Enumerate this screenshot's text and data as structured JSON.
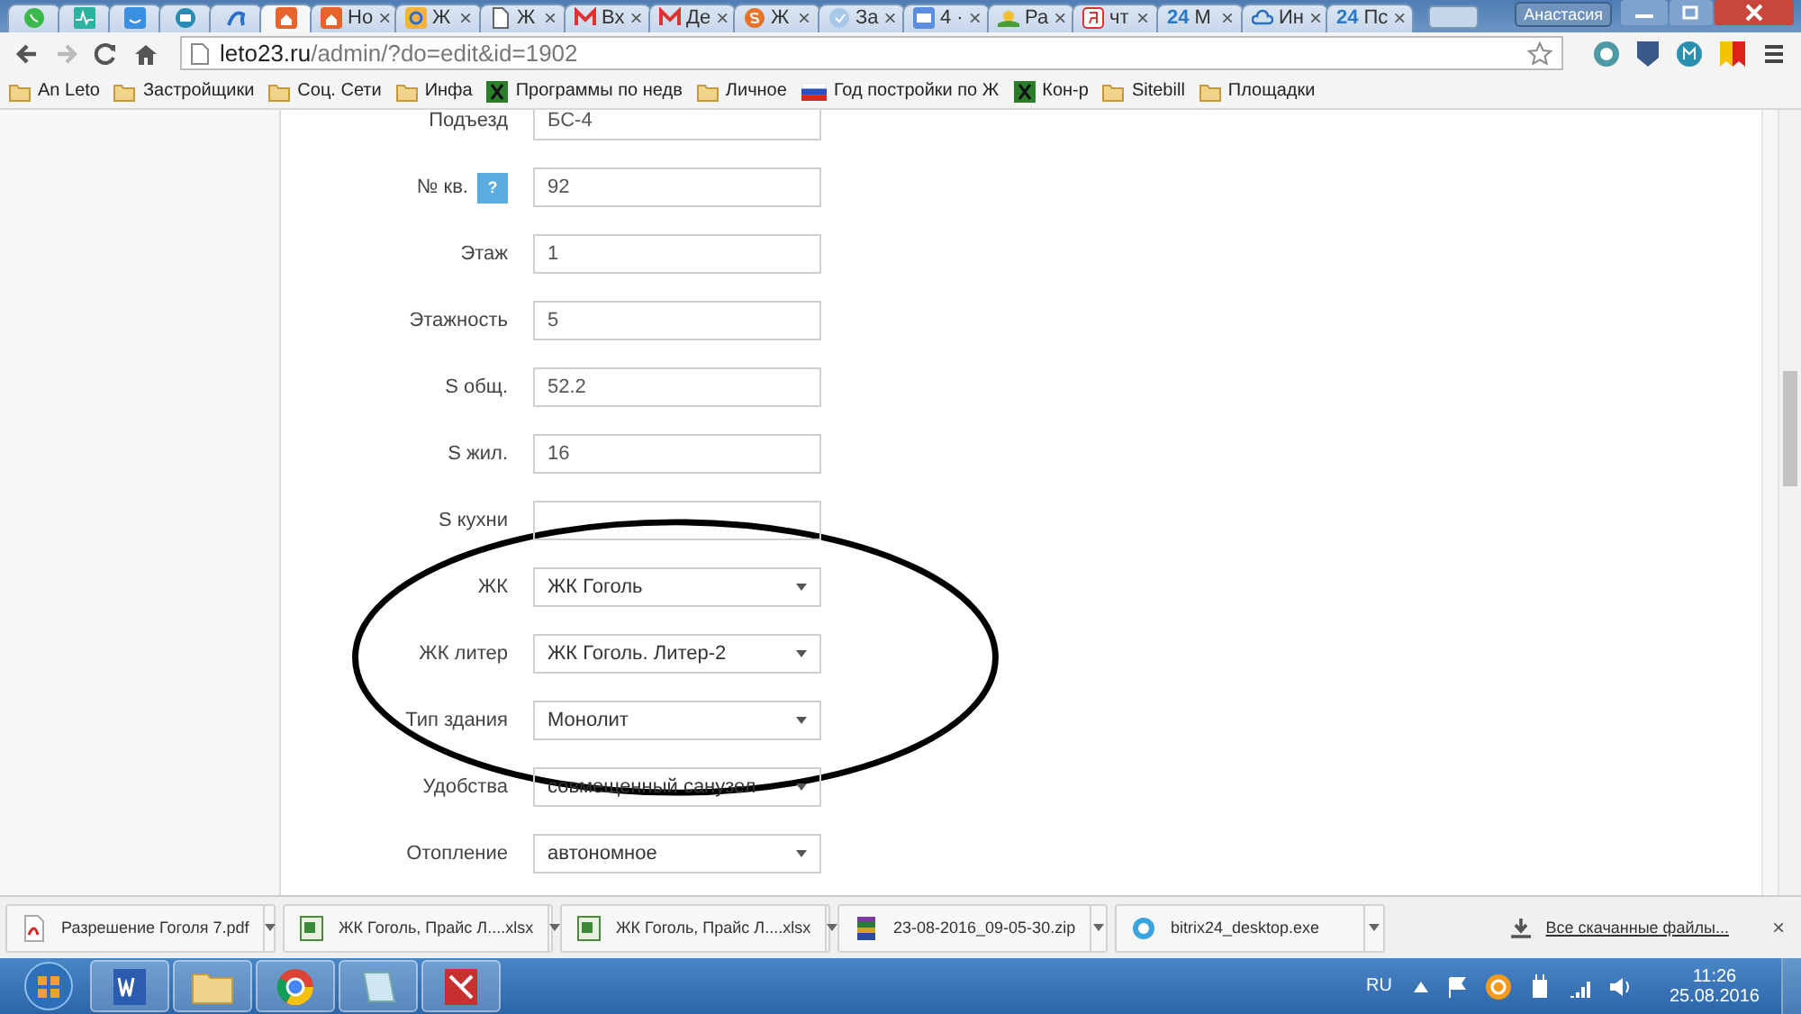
{
  "browser": {
    "tabs": [
      {
        "pinned": true,
        "selected": false
      },
      {
        "pinned": true,
        "selected": false
      },
      {
        "pinned": true,
        "selected": false
      },
      {
        "pinned": true,
        "selected": false
      },
      {
        "pinned": true,
        "selected": false
      },
      {
        "pinned": true,
        "selected": true
      },
      {
        "pinned": false,
        "title": "Но",
        "selected": false
      },
      {
        "pinned": false,
        "title": "Ж",
        "selected": false
      },
      {
        "pinned": false,
        "title": "Ж",
        "selected": false
      },
      {
        "pinned": false,
        "title": "Вх",
        "selected": false
      },
      {
        "pinned": false,
        "title": "Де",
        "selected": false
      },
      {
        "pinned": false,
        "title": "Ж",
        "selected": false
      },
      {
        "pinned": false,
        "title": "За",
        "selected": false
      },
      {
        "pinned": false,
        "title": "4 ·",
        "selected": false
      },
      {
        "pinned": false,
        "title": "Ра",
        "selected": false
      },
      {
        "pinned": false,
        "title": "чт",
        "selected": false
      },
      {
        "pinned": false,
        "title": "М",
        "badge": "24",
        "selected": false
      },
      {
        "pinned": false,
        "title": "Ин",
        "selected": false
      },
      {
        "pinned": false,
        "title": "Пс",
        "badge": "24",
        "selected": false
      }
    ],
    "tab_close": "×",
    "user": "Анастасия",
    "url_host": "leto23.ru",
    "url_path": "/admin/?do=edit&id=1902",
    "bookmarks": [
      {
        "kind": "folder",
        "label": "An Leto"
      },
      {
        "kind": "folder",
        "label": "Застройщики"
      },
      {
        "kind": "folder",
        "label": "Соц. Сети"
      },
      {
        "kind": "folder",
        "label": "Инфа"
      },
      {
        "kind": "site",
        "label": "Программы по недв"
      },
      {
        "kind": "folder",
        "label": "Личное"
      },
      {
        "kind": "flag",
        "label": "Год постройки по Ж"
      },
      {
        "kind": "site",
        "label": "Кон-р"
      },
      {
        "kind": "folder",
        "label": "Sitebill"
      },
      {
        "kind": "folder",
        "label": "Площадки"
      }
    ]
  },
  "form": {
    "rows": [
      {
        "label": "Подъезд",
        "kind": "text",
        "value": "БС-4"
      },
      {
        "label": "№ кв.",
        "kind": "text",
        "value": "92",
        "help": "?"
      },
      {
        "label": "Этаж",
        "kind": "text",
        "value": "1"
      },
      {
        "label": "Этажность",
        "kind": "text",
        "value": "5"
      },
      {
        "label": "S общ.",
        "kind": "text",
        "value": "52.2"
      },
      {
        "label": "S жил.",
        "kind": "text",
        "value": "16"
      },
      {
        "label": "S кухни",
        "kind": "text"
      },
      {
        "label": "ЖК",
        "kind": "select",
        "value": "ЖК Гоголь"
      },
      {
        "label": "ЖК литер",
        "kind": "select",
        "value": "ЖК Гоголь. Литер-2"
      },
      {
        "label": "Тип здания",
        "kind": "select",
        "value": "Монолит"
      },
      {
        "label": "Удобства",
        "kind": "select",
        "value": "совмещенный санузел"
      },
      {
        "label": "Отопление",
        "kind": "select",
        "value": "автономное"
      }
    ]
  },
  "downloads": {
    "items": [
      {
        "kind": "pdf",
        "name": "Разрешение Гоголя 7.pdf"
      },
      {
        "kind": "xlsx",
        "name": "ЖК Гоголь, Прайс Л....xlsx"
      },
      {
        "kind": "xlsx",
        "name": "ЖК Гоголь, Прайс Л....xlsx"
      },
      {
        "kind": "zip",
        "name": "23-08-2016_09-05-30.zip"
      },
      {
        "kind": "exe",
        "name": "bitrix24_desktop.exe"
      }
    ],
    "show_all": "Все скачанные файлы...",
    "close": "×"
  },
  "taskbar": {
    "language": "RU",
    "time": "11:26",
    "date": "25.08.2016"
  }
}
